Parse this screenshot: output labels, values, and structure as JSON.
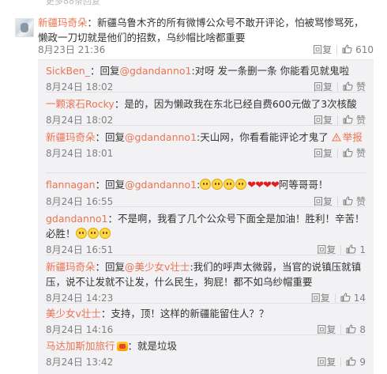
{
  "top_strip_text": "更多88条回复",
  "main": {
    "user": "新疆玛奇朵",
    "text": "：新疆乌鲁木齐的所有微博公众号不敢开评论，怕被骂惨骂死，懒政一刀切就是他们的招数，乌纱帽比啥都重要",
    "time": "8月23日 21:36",
    "reply_label": "回复",
    "like_count": "610"
  },
  "replies": [
    {
      "user": "SickBen_",
      "pre": "：回复",
      "mention": "@gdandanno1",
      "text": ":对呀 发一条删一条 你能看见就鬼啦",
      "time": "8月24日 18:02",
      "reply": "回复",
      "like": "赞"
    },
    {
      "user": "一颗滚石Rocky",
      "pre": "：是的，因为懒政我在东北已经自费600元做了3次核酸",
      "mention": "",
      "text": "",
      "time": "8月24日 18:02",
      "reply": "回复",
      "like": "赞"
    },
    {
      "user": "新疆玛奇朵",
      "pre": "：回复",
      "mention": "@gdandanno1",
      "text": ":天山网，你看看能评论才鬼了",
      "report": "举报",
      "report_tail": "",
      "time": "8月24日 18:01",
      "reply": "回复",
      "like": "赞"
    },
    {
      "user": "flannagan",
      "pre": "：回复",
      "mention": "@gdandanno1",
      "text_after": "阿等哥哥！",
      "time": "8月24日 16:55",
      "reply": "回复",
      "like": "赞"
    },
    {
      "user": "gdandanno1",
      "pre": "：不是啊，我看了几个公众号下面全是加油！胜利！辛苦！必胜！",
      "time": "8月24日 16:51",
      "reply": "回复",
      "like": "1"
    },
    {
      "user": "新疆玛奇朵",
      "pre": "：回复",
      "mention": "@美少女v壮士",
      "text": ":我们的呼声太微弱，当官的说镇压就镇压，说不让发就不让发，什么民生，狗屁！都不如乌纱帽重要",
      "time": "8月24日 14:23",
      "reply": "回复",
      "like": "14"
    },
    {
      "user": "美少女v壮士",
      "pre": "：支持，顶！这样的新疆能留住人？？",
      "time": "8月24日 14:16",
      "reply": "回复",
      "like": "8"
    },
    {
      "user": "马达加斯加旅行",
      "pre": "：就是垃圾",
      "time": "8月24日 13:42",
      "reply": "回复",
      "like": "9"
    }
  ]
}
